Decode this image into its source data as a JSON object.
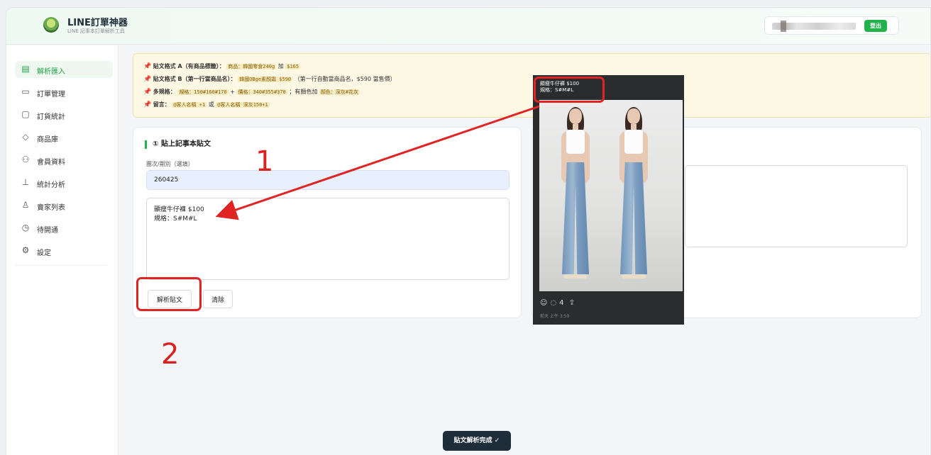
{
  "header": {
    "title": "LINE訂單神器",
    "subtitle": "LINE 記事本訂單解析工具",
    "logout_label": "登出"
  },
  "sidebar": {
    "items": [
      {
        "label": "解析匯入",
        "icon": "document-icon",
        "active": true
      },
      {
        "label": "訂單管理",
        "icon": "box-icon",
        "active": false
      },
      {
        "label": "訂貨統計",
        "icon": "monitor-icon",
        "active": false
      },
      {
        "label": "商品庫",
        "icon": "tag-icon",
        "active": false
      },
      {
        "label": "會員資料",
        "icon": "users-icon",
        "active": false
      },
      {
        "label": "統計分析",
        "icon": "bar-chart-icon",
        "active": false
      },
      {
        "label": "賣家列表",
        "icon": "user-icon",
        "active": false
      },
      {
        "label": "待開通",
        "icon": "clock-icon",
        "active": false
      },
      {
        "label": "設定",
        "icon": "gear-icon",
        "active": false
      }
    ]
  },
  "tips": {
    "a": {
      "title": "貼文格式 A（有商品標籤）：",
      "code1": "商品：韓國零食240g",
      "mid": "加",
      "code2": "$165"
    },
    "b": {
      "title": "貼文格式 B（第一行當商品名）：",
      "code1": "韓國OBge素顏霜 $590",
      "note": "（第一行自動當商品名，$590 當售價）"
    },
    "c": {
      "title": "多規格：",
      "code1": "規格：150#160#170",
      "plus": "+",
      "code2": "價格：340#355#370",
      "note": "；有顏色加",
      "code3": "顏色：深灰#花灰"
    },
    "d": {
      "title": "留言：",
      "code1": "@客人名稱 +1",
      "or": "或",
      "code2": "@客人名稱 深灰150+1"
    }
  },
  "left_card": {
    "title": "① 貼上記事本貼文",
    "period_label": "團次/期別（選填）",
    "period_value": "260425",
    "post_text": "顯瘦牛仔褲 $100\n規格：S#M#L",
    "parse_label": "解析貼文",
    "clear_label": "清除"
  },
  "toast": "貼文解析完成 ✓",
  "screenshot_panel": {
    "caption_line1": "顯瘦牛仔褲 $100",
    "caption_line2": "規格：S#M#L",
    "comment_count": "4",
    "time": "前天 上午 3:50"
  },
  "annotations": {
    "step1": "1",
    "step2": "2",
    "color": "#e02424"
  },
  "colors": {
    "accent": "#22b14c",
    "tips_bg": "#fdf8e4",
    "toast_bg": "#1f2d3a"
  }
}
